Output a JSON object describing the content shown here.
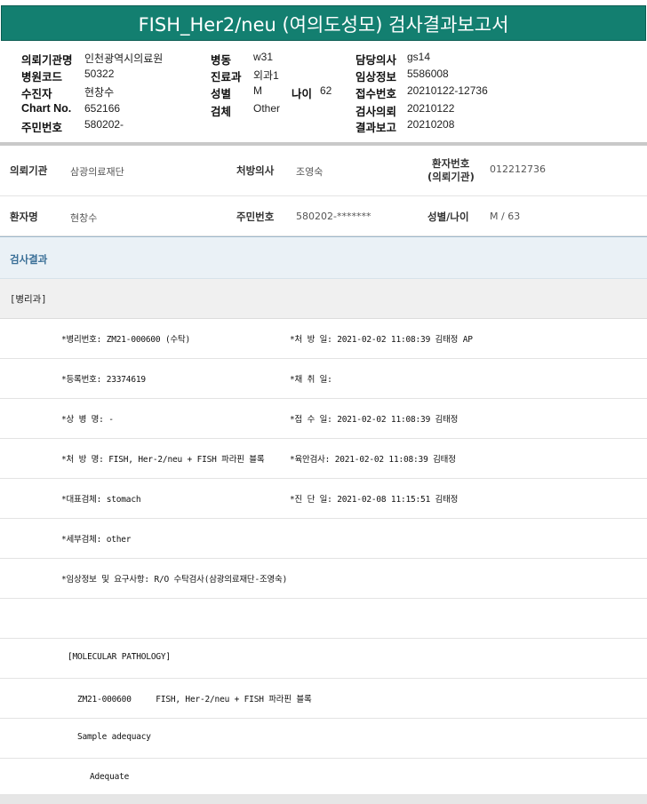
{
  "title": "FISH_Her2/neu (여의도성모) 검사결과보고서",
  "report_header": {
    "rows": [
      {
        "l1": "의뢰기관명",
        "v1": "인천광역시의료원",
        "l2": "병동",
        "v2": "w31",
        "l3": "",
        "v3": "",
        "l4": "담당의사",
        "v4": "gs14"
      },
      {
        "l1": "병원코드",
        "v1": "50322",
        "l2": "진료과",
        "v2": "외과1",
        "l3": "",
        "v3": "",
        "l4": "임상정보",
        "v4": "5586008"
      },
      {
        "l1": "수진자",
        "v1": "현창수",
        "l2": "성별",
        "v2": "M",
        "l3": "나이",
        "v3": "62",
        "l4": "접수번호",
        "v4": "20210122-12736"
      },
      {
        "l1": "Chart No.",
        "v1": "652166",
        "l2": "검체",
        "v2": "Other",
        "l3": "",
        "v3": "",
        "l4": "검사의뢰",
        "v4": "20210122"
      },
      {
        "l1": "주민번호",
        "v1": "580202-",
        "l2": "",
        "v2": "",
        "l3": "",
        "v3": "",
        "l4": "결과보고",
        "v4": "20210208"
      }
    ]
  },
  "summary": {
    "row1": {
      "org_label": "의뢰기관",
      "org_value": "삼광의료재단",
      "doctor_label": "처방의사",
      "doctor_value": "조영숙",
      "patno_label_1": "환자번호",
      "patno_label_2": "(의뢰기관)",
      "patno_value": "012212736"
    },
    "row2": {
      "name_label": "환자명",
      "name_value": "현창수",
      "rrn_label": "주민번호",
      "rrn_value": "580202-*******",
      "sexage_label": "성별/나이",
      "sexage_value": "M / 63"
    }
  },
  "result_section": {
    "header": "검사결과",
    "dept": "[병리과]",
    "details": [
      {
        "left": "*병리번호: ZM21-000600 (수탁)",
        "right": "*처 방 일: 2021-02-02 11:08:39  김태정 AP"
      },
      {
        "left": "*등록번호: 23374619",
        "right": "*채 취 일:"
      },
      {
        "left": "*상 병 명: -",
        "right": "*접 수 일: 2021-02-02 11:08:39  김태정"
      },
      {
        "left": "*처 방 명: FISH, Her-2/neu + FISH 파라핀 블록",
        "right": "*육안검사: 2021-02-02 11:08:39  김태정"
      },
      {
        "left": "*대표검체: stomach",
        "right": "*진 단 일: 2021-02-08 11:15:51  김태정"
      },
      {
        "left": "*세부검체: other",
        "right": ""
      },
      {
        "left": "*임상정보 및 요구사항: R/O 수탁검사(삼광의료재단-조영숙)",
        "right": ""
      },
      {
        "left": "",
        "right": ""
      }
    ],
    "molecular": {
      "heading": "[MOLECULAR PATHOLOGY]",
      "item": "ZM21-000600     FISH, Her-2/neu + FISH 파라핀 블록",
      "adequacy_label": "Sample adequacy",
      "adequacy_value": "Adequate"
    }
  }
}
